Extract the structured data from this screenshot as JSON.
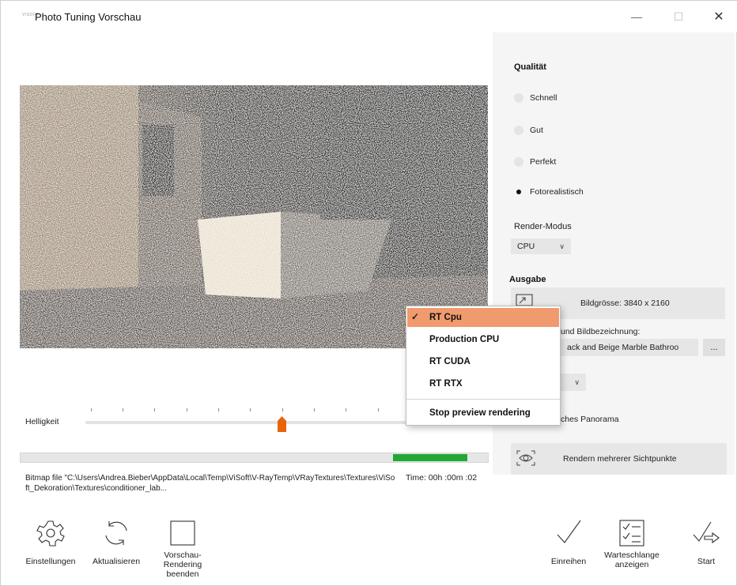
{
  "window": {
    "app_icon_text": "VISOFT",
    "title": "Photo Tuning Vorschau",
    "minimize_symbol": "—",
    "maximize_symbol": "☐",
    "close_symbol": "✕"
  },
  "quality": {
    "title": "Qualität",
    "options": [
      {
        "label": "Schnell",
        "checked": false
      },
      {
        "label": "Gut",
        "checked": false
      },
      {
        "label": "Perfekt",
        "checked": false
      },
      {
        "label": "Fotorealistisch",
        "checked": true
      }
    ],
    "render_mode_label": "Render-Modus",
    "render_mode_value": "CPU"
  },
  "output": {
    "title": "Ausgabe",
    "image_size_label": "Bildgrösse: 3840 x 2160",
    "filename_label_partial": "und Bildbezeichnung:",
    "filename_value_partial": "ack and Beige Marble Bathroo",
    "browse_button": "...",
    "panorama_label_partial": "ches Panorama",
    "multi_view_button": "Rendern mehrerer Sichtpunkte"
  },
  "slider": {
    "label": "Helligkeit",
    "value_fraction": 0.6,
    "accent_color": "#e8630a"
  },
  "progress": {
    "fraction": 0.16,
    "color": "#22a836",
    "bitmap_text": "Bitmap file \"C:\\Users\\Andrea.Bieber\\AppData\\Local\\Temp\\ViSoft\\V-RayTemp\\VRayTextures\\Textures\\ViSoft_Dekoration\\Textures\\conditioner_lab...",
    "time_text": "Time: 00h :00m :02"
  },
  "toolbar_left": [
    {
      "label": "Einstellungen",
      "icon": "gear-icon"
    },
    {
      "label": "Aktualisieren",
      "icon": "refresh-icon"
    },
    {
      "label": "Vorschau-Rendering beenden",
      "icon": "stop-square-icon"
    }
  ],
  "toolbar_right": [
    {
      "label": "Einreihen",
      "icon": "checkmark-icon"
    },
    {
      "label": "Warteschlange anzeigen",
      "icon": "checklist-icon"
    },
    {
      "label": "Start",
      "icon": "check-arrow-icon"
    }
  ],
  "render_menu": {
    "items": [
      {
        "label": "RT Cpu",
        "selected": true
      },
      {
        "label": "Production CPU",
        "selected": false
      },
      {
        "label": "RT CUDA",
        "selected": false
      },
      {
        "label": "RT RTX",
        "selected": false
      }
    ],
    "stop_label": "Stop preview rendering",
    "highlight_color": "#f19a6d"
  }
}
